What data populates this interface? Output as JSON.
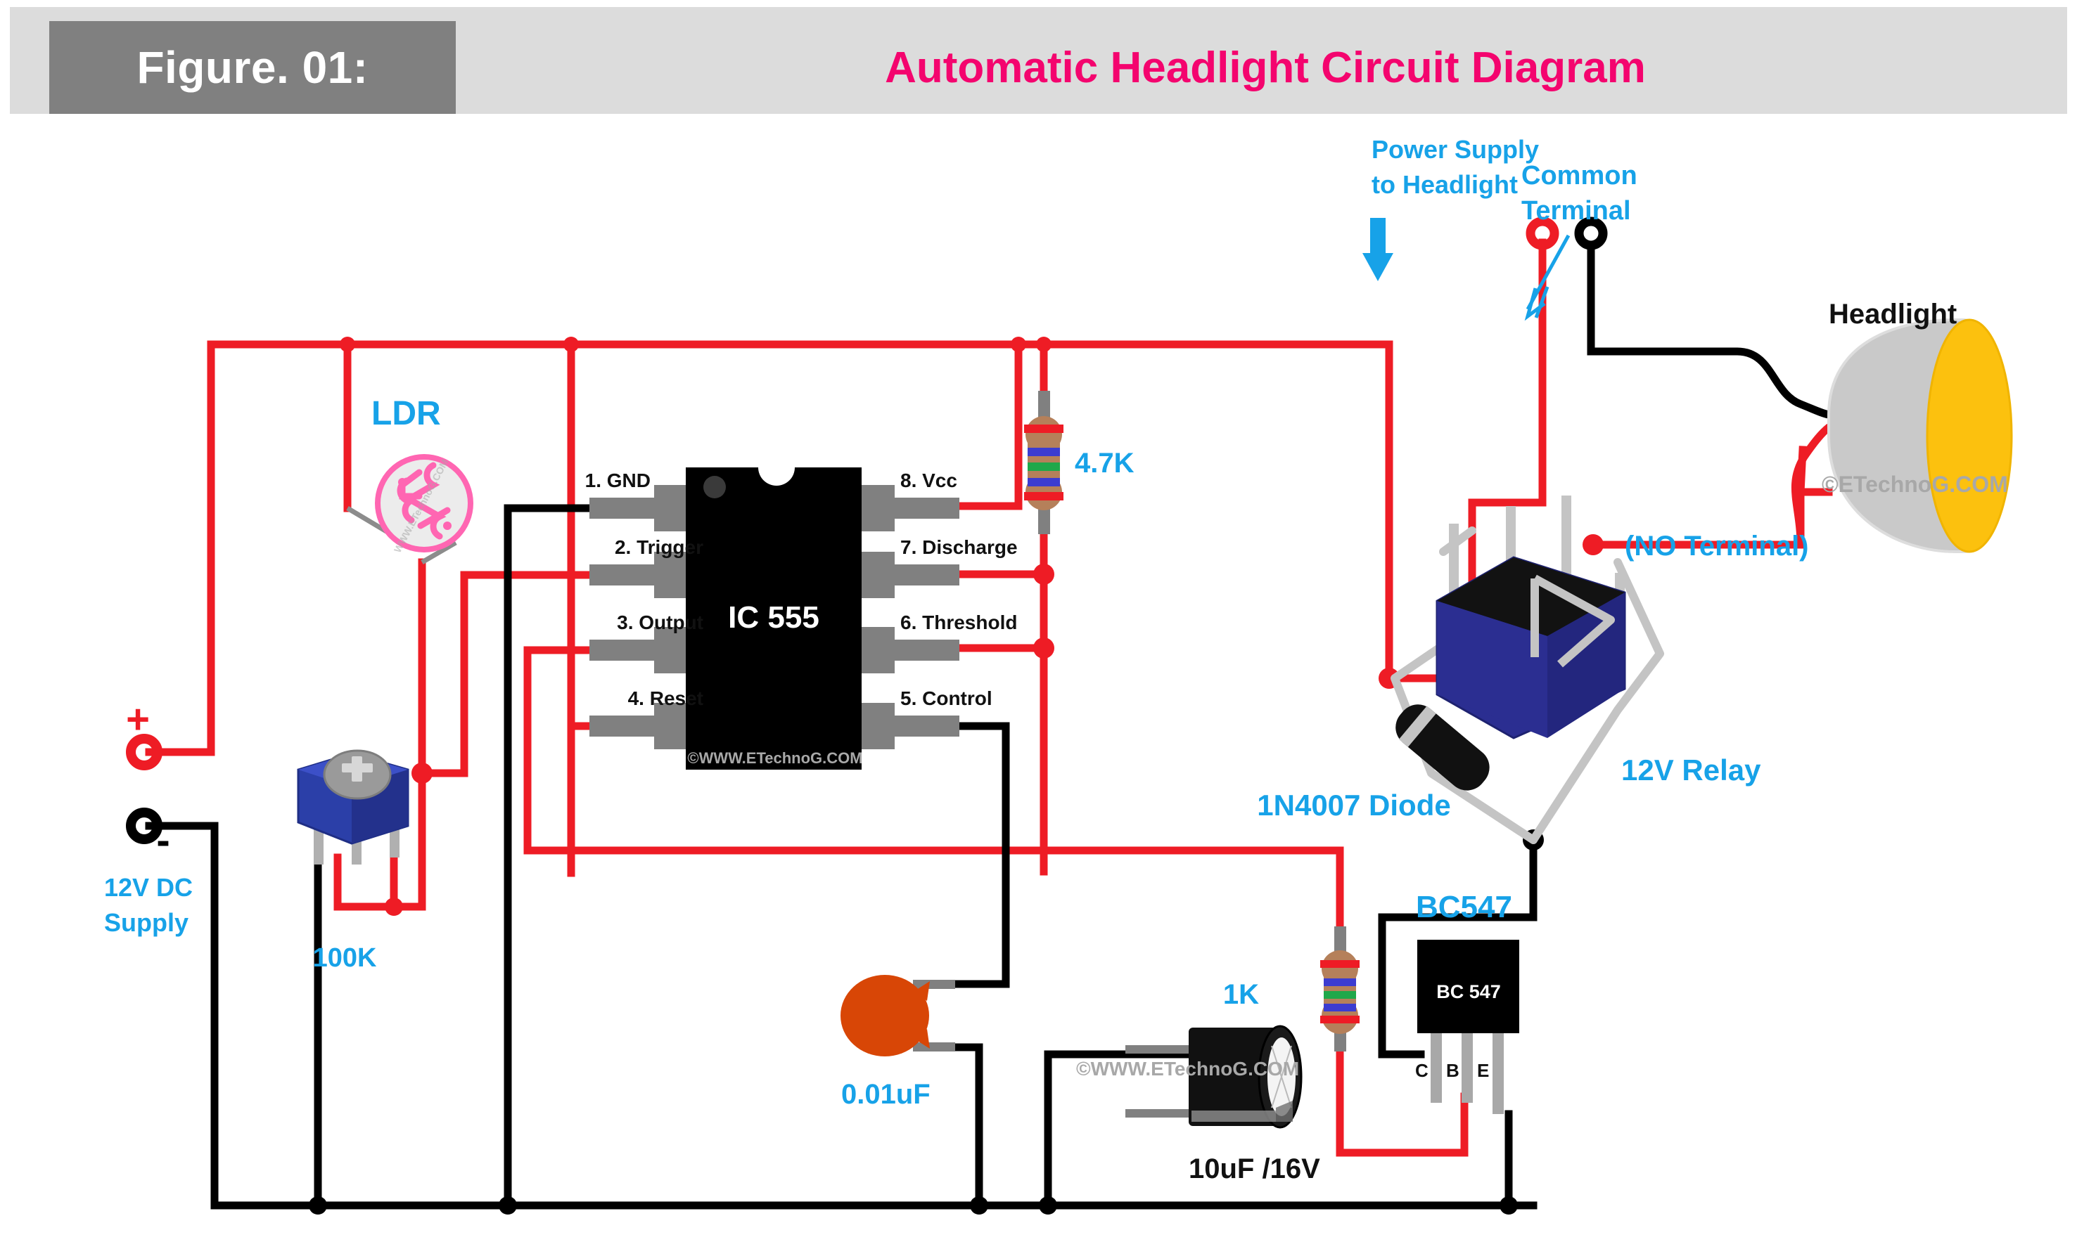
{
  "header": {
    "figure_label": "Figure. 01:",
    "title": "Automatic Headlight Circuit Diagram",
    "title_color": "#f4046e",
    "figure_box_color": "#808080",
    "bar_color": "#dcdcdc"
  },
  "colors": {
    "positive_wire": "#ee1c25",
    "negative_wire": "#000000",
    "label_accent": "#17a2e8",
    "relay_body": "#2b2e91",
    "headlight_lens": "#fcc10e",
    "headlight_body": "#c9c9c9",
    "ic_body": "#000000",
    "pin_metal": "#808080",
    "resistor_body": "#b5805a",
    "trimpot_body": "#2b3fa8",
    "ldr_ring": "#ff66b2",
    "disc_cap": "#d84606",
    "electrolytic_cap": "#111111",
    "transistor_body": "#000000"
  },
  "ic": {
    "name": "IC 555",
    "watermark": "©WWW.ETechnoG.COM",
    "pins_left": [
      {
        "num": "1.",
        "name": "GND",
        "label": "1. GND"
      },
      {
        "num": "2.",
        "name": "Trigger",
        "label": "2. Trigger"
      },
      {
        "num": "3.",
        "name": "Output",
        "label": "3. Output"
      },
      {
        "num": "4.",
        "name": "Reset",
        "label": "4. Reset"
      }
    ],
    "pins_right": [
      {
        "num": "8.",
        "name": "Vcc",
        "label": "8. Vcc"
      },
      {
        "num": "7.",
        "name": "Discharge",
        "label": "7. Discharge"
      },
      {
        "num": "6.",
        "name": "Threshold",
        "label": "6. Threshold"
      },
      {
        "num": "5.",
        "name": "Control",
        "label": "5. Control"
      }
    ]
  },
  "components": {
    "ldr": "LDR",
    "trimpot": "100K",
    "resistor_top": "4.7K",
    "resistor_base": "1K",
    "disc_cap": "0.01uF",
    "electrolytic_cap": "10uF /16V",
    "transistor_label": "BC547",
    "transistor_body_text": "BC 547",
    "transistor_pins": [
      "C",
      "B",
      "E"
    ],
    "diode": "1N4007 Diode",
    "relay": "12V Relay",
    "headlight": "Headlight"
  },
  "annotations": {
    "supply": "12V DC Supply",
    "supply_line1": "12V DC",
    "supply_line2": "Supply",
    "plus": "+",
    "minus": "-",
    "power_headlight_line1": "Power Supply",
    "power_headlight_line2": "to Headlight",
    "common_terminal_line1": "Common",
    "common_terminal_line2": "Terminal",
    "no_terminal": "(NO Terminal)",
    "watermark_ic": "©WWW.ETechnoG.COM",
    "watermark_cap": "©WWW.ETechnoG.COM",
    "watermark_headlight": "©ETechnoG.COM",
    "watermark_ldr": "WWW.ETechnoG.COM"
  }
}
